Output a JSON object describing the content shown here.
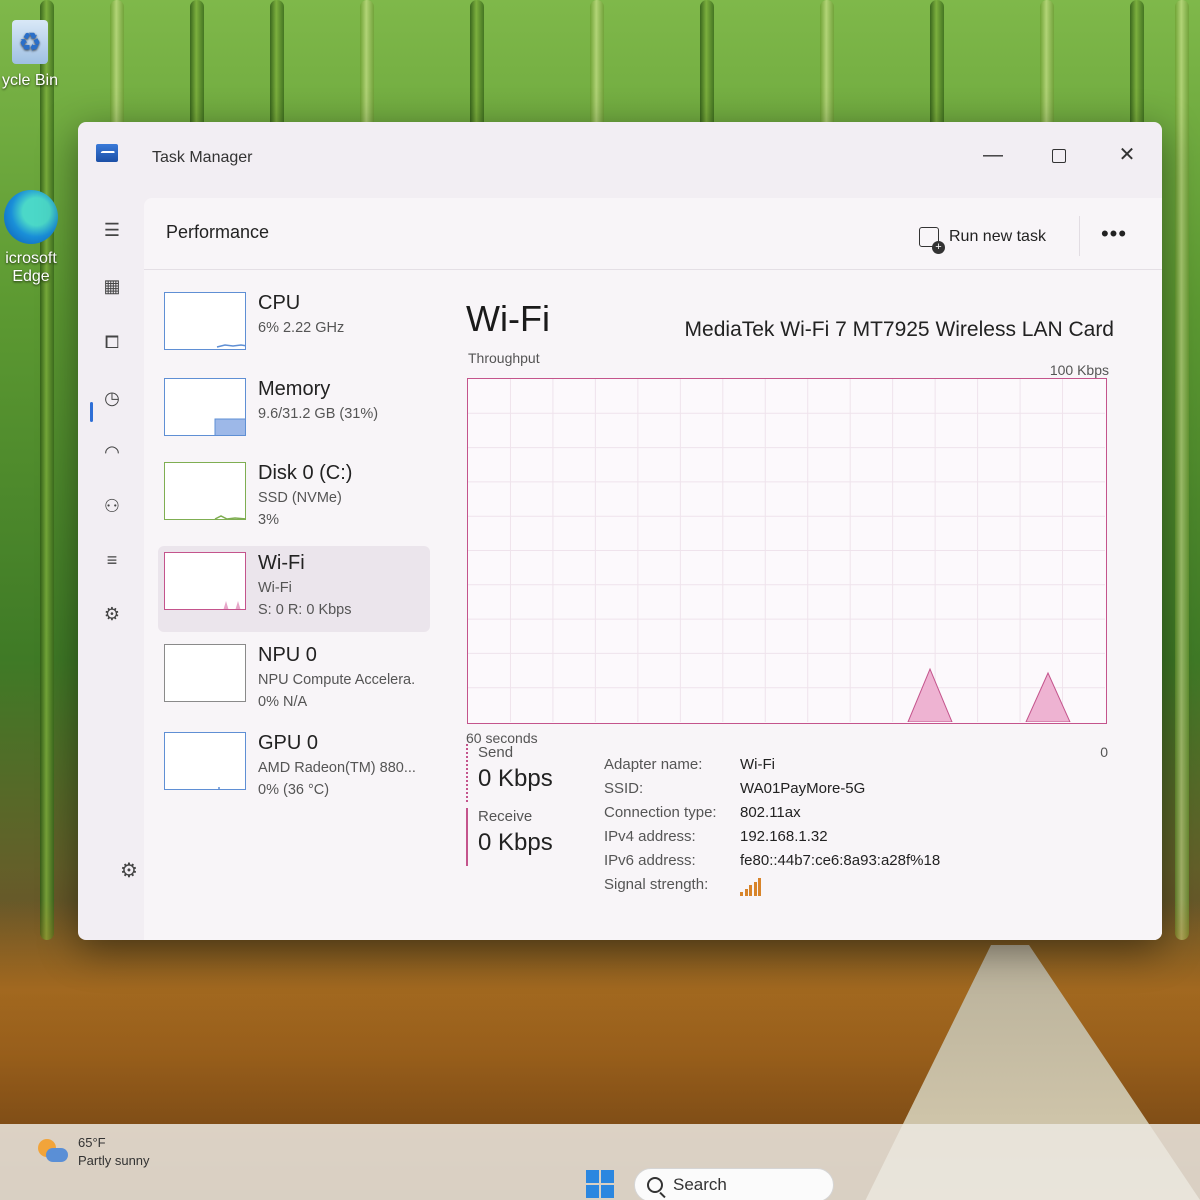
{
  "desktop": {
    "recycle_bin_label": "ycle Bin",
    "edge_label_1": "icrosoft",
    "edge_label_2": "Edge"
  },
  "window": {
    "title": "Task Manager",
    "minimize_glyph": "—",
    "close_glyph": "✕"
  },
  "rail": {
    "icons": [
      "hamburger-menu-icon",
      "processes-icon",
      "performance-icon",
      "app-history-icon",
      "startup-apps-icon",
      "users-icon",
      "details-icon",
      "services-icon",
      "settings-icon"
    ]
  },
  "header": {
    "page_title": "Performance",
    "run_new_task": "Run new task",
    "more_glyph": "•••"
  },
  "devices": [
    {
      "name": "CPU",
      "line1": "6% 2.22 GHz",
      "line2": ""
    },
    {
      "name": "Memory",
      "line1": "9.6/31.2 GB (31%)",
      "line2": ""
    },
    {
      "name": "Disk 0 (C:)",
      "line1": "SSD (NVMe)",
      "line2": "3%"
    },
    {
      "name": "Wi-Fi",
      "line1": "Wi-Fi",
      "line2": "S: 0 R: 0 Kbps"
    },
    {
      "name": "NPU 0",
      "line1": "NPU Compute Accelera.",
      "line2": "0% N/A"
    },
    {
      "name": "GPU 0",
      "line1": "AMD Radeon(TM) 880...",
      "line2": "0% (36 °C)"
    }
  ],
  "wifi": {
    "title": "Wi-Fi",
    "adapter_full_name": "MediaTek Wi-Fi 7 MT7925 Wireless LAN Card",
    "throughput_label": "Throughput",
    "max_label": "100 Kbps",
    "time_label": "60 seconds",
    "zero_label": "0",
    "send_label": "Send",
    "send_value": "0 Kbps",
    "receive_label": "Receive",
    "receive_value": "0 Kbps",
    "graph_color": "#c4548c",
    "properties": [
      {
        "label": "Adapter name:",
        "value": "Wi-Fi"
      },
      {
        "label": "SSID:",
        "value": "WA01PayMore-5G"
      },
      {
        "label": "Connection type:",
        "value": "802.11ax"
      },
      {
        "label": "IPv4 address:",
        "value": "192.168.1.32"
      },
      {
        "label": "IPv6 address:",
        "value": "fe80::44b7:ce6:8a93:a28f%18"
      },
      {
        "label": "Signal strength:",
        "value": ""
      }
    ],
    "signal_bars_lit": 5,
    "signal_bars_total": 5
  },
  "taskbar": {
    "temperature": "65°F",
    "condition": "Partly sunny",
    "search_label": "Search"
  }
}
